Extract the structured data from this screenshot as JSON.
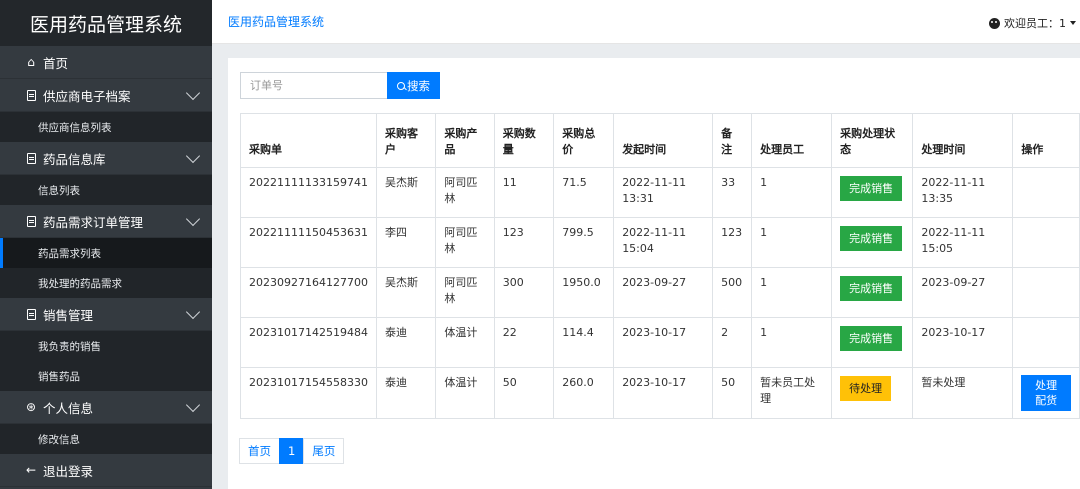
{
  "app": {
    "title": "医用药品管理系统"
  },
  "sidebar": {
    "items": [
      {
        "label": "首页",
        "icon": "home-icon"
      },
      {
        "label": "供应商电子档案",
        "icon": "document-icon",
        "sub": [
          "供应商信息列表"
        ]
      },
      {
        "label": "药品信息库",
        "icon": "document-icon",
        "sub": [
          "信息列表"
        ]
      },
      {
        "label": "药品需求订单管理",
        "icon": "document-icon",
        "sub": [
          "药品需求列表",
          "我处理的药品需求"
        ]
      },
      {
        "label": "销售管理",
        "icon": "document-icon",
        "sub": [
          "我负责的销售",
          "销售药品"
        ]
      },
      {
        "label": "个人信息",
        "icon": "user-icon",
        "sub": [
          "修改信息"
        ]
      },
      {
        "label": "退出登录",
        "icon": "arrow-left-icon"
      }
    ],
    "active_sub": "药品需求列表"
  },
  "header": {
    "breadcrumb": "医用药品管理系统",
    "welcome": "欢迎员工：1"
  },
  "search": {
    "placeholder": "订单号",
    "button": "搜索"
  },
  "table": {
    "columns": [
      "采购单",
      "采购客户",
      "采购产品",
      "采购数量",
      "采购总价",
      "发起时间",
      "备注",
      "处理员工",
      "采购处理状态",
      "处理时间",
      "操作"
    ],
    "rows": [
      {
        "id": "20221111133159741",
        "customer": "吴杰斯",
        "product": "阿司匹林",
        "qty": "11",
        "total": "71.5",
        "start": "2022-11-11 13:31",
        "note": "33",
        "staff": "1",
        "status": "完成销售",
        "status_kind": "done",
        "time": "2022-11-11 13:35",
        "action": ""
      },
      {
        "id": "20221111150453631",
        "customer": "李四",
        "product": "阿司匹林",
        "qty": "123",
        "total": "799.5",
        "start": "2022-11-11 15:04",
        "note": "123",
        "staff": "1",
        "status": "完成销售",
        "status_kind": "done",
        "time": "2022-11-11 15:05",
        "action": ""
      },
      {
        "id": "20230927164127700",
        "customer": "吴杰斯",
        "product": "阿司匹林",
        "qty": "300",
        "total": "1950.0",
        "start": "2023-09-27",
        "note": "500",
        "staff": "1",
        "status": "完成销售",
        "status_kind": "done",
        "time": "2023-09-27",
        "action": ""
      },
      {
        "id": "20231017142519484",
        "customer": "泰迪",
        "product": "体温计",
        "qty": "22",
        "total": "114.4",
        "start": "2023-10-17",
        "note": "2",
        "staff": "1",
        "status": "完成销售",
        "status_kind": "done",
        "time": "2023-10-17",
        "action": ""
      },
      {
        "id": "20231017154558330",
        "customer": "泰迪",
        "product": "体温计",
        "qty": "50",
        "total": "260.0",
        "start": "2023-10-17",
        "note": "50",
        "staff": "暂未员工处理",
        "status": "待处理",
        "status_kind": "pending",
        "time": "暂未处理",
        "action": "处理配货"
      }
    ]
  },
  "pagination": {
    "first": "首页",
    "current": "1",
    "last": "尾页"
  },
  "colors": {
    "primary": "#007bff",
    "success": "#28a745",
    "warning": "#ffc107",
    "sidebar": "#343a40"
  }
}
